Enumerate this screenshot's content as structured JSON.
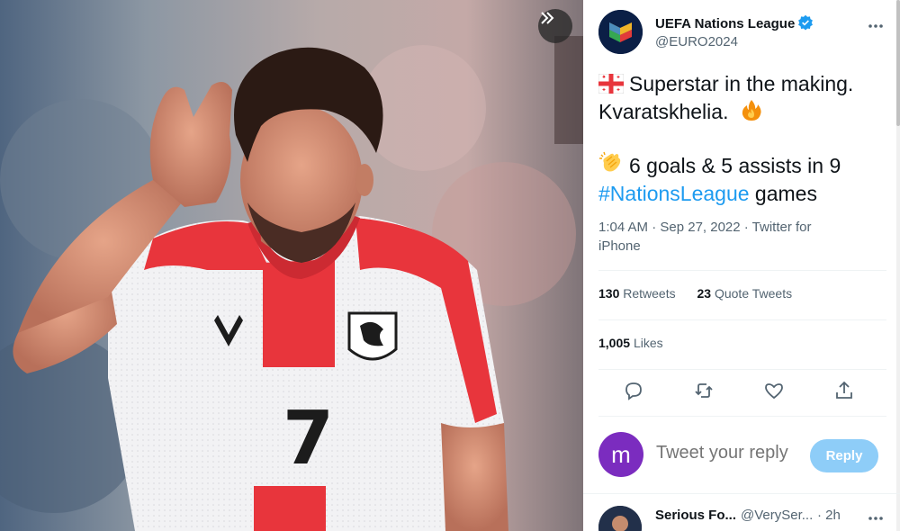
{
  "media": {
    "jersey_number": "7",
    "expand_icon": "chevrons-right-icon"
  },
  "tweet": {
    "author_name": "UEFA Nations League",
    "author_handle": "@EURO2024",
    "line1": "Superstar in the making.",
    "line2": "Kvaratskhelia.",
    "line3": "6 goals & 5 assists in 9",
    "hashtag": "#NationsLeague",
    "line4_tail": " games",
    "meta_time": "1:04 AM · Sep 27, 2022 · Twitter for iPhone"
  },
  "stats": {
    "retweets_count": "130",
    "retweets_label": "Retweets",
    "quotes_count": "23",
    "quotes_label": "Quote Tweets",
    "likes_count": "1,005",
    "likes_label": "Likes"
  },
  "actions": [
    "reply-icon",
    "retweet-icon",
    "like-icon",
    "share-icon"
  ],
  "reply_box": {
    "avatar_letter": "m",
    "placeholder": "Tweet your reply",
    "button_label": "Reply"
  },
  "reply": {
    "name": "Serious Fo...",
    "handle": "@VerySer...",
    "time": "· 2h"
  },
  "colors": {
    "accent": "#1d9bf0",
    "reply_button": "#8ecdf8",
    "avatar_m": "#7b2cbf",
    "text_secondary": "#536471"
  }
}
